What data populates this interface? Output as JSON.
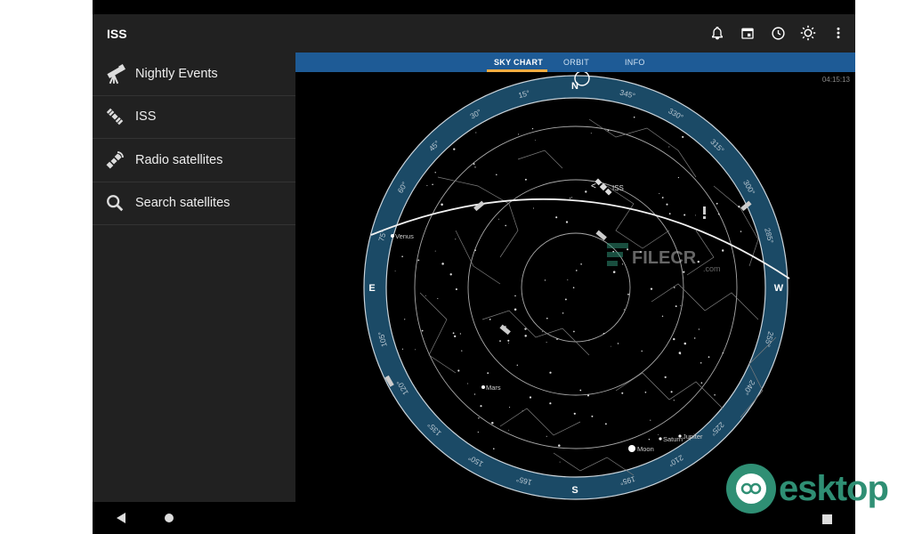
{
  "app": {
    "title": "ISS",
    "toolbar_icons": [
      "bell-icon",
      "calendar-icon",
      "clock-icon",
      "night-mode-icon",
      "more-vert-icon"
    ]
  },
  "drawer": {
    "items": [
      {
        "label": "Nightly Events",
        "icon": "telescope-icon"
      },
      {
        "label": "ISS",
        "icon": "satellite-icon"
      },
      {
        "label": "Radio satellites",
        "icon": "radio-satellite-icon"
      },
      {
        "label": "Search satellites",
        "icon": "search-icon"
      }
    ]
  },
  "tabs": {
    "items": [
      {
        "label": "SKY CHART",
        "active": true
      },
      {
        "label": "ORBIT",
        "active": false
      },
      {
        "label": "INFO",
        "active": false
      }
    ]
  },
  "sky": {
    "time": "04:15:13",
    "directions": {
      "north": "N",
      "south": "S",
      "east": "E",
      "west": "W"
    },
    "degree_labels": [
      "15°",
      "30°",
      "45°",
      "60°",
      "75°",
      "105°",
      "120°",
      "135°",
      "150°",
      "165°",
      "195°",
      "210°",
      "225°",
      "240°",
      "255°",
      "285°",
      "300°",
      "315°",
      "330°",
      "345°"
    ],
    "objects": [
      {
        "label": "ISS"
      },
      {
        "label": "Venus"
      },
      {
        "label": "Mars"
      },
      {
        "label": "Moon"
      },
      {
        "label": "Saturn"
      },
      {
        "label": "Jupiter"
      }
    ]
  },
  "colors": {
    "accent": "#f4ad42",
    "tabbar": "#1e5b96",
    "ring": "#1b4a66",
    "panel": "#212121"
  },
  "watermarks": {
    "filecr": "FILECR",
    "filecr_suffix": ".com",
    "desktop": "esktop"
  }
}
